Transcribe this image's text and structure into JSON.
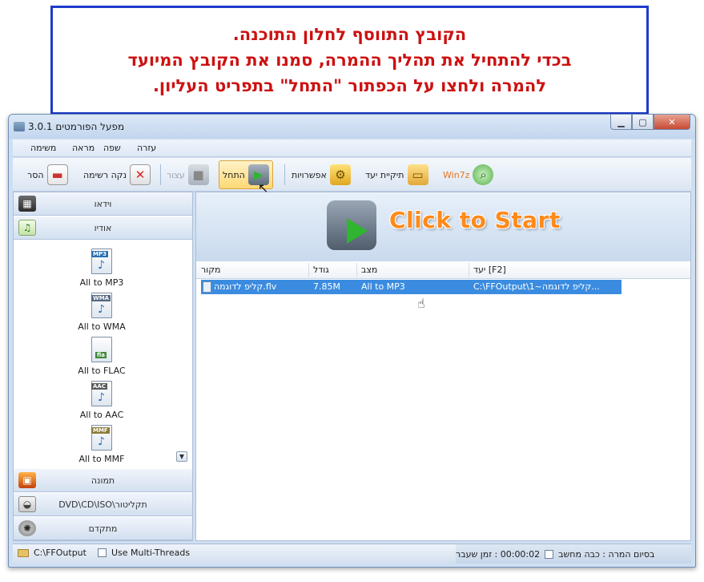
{
  "annotation": {
    "lines": [
      "הקובץ התווסף לחלון התוכנה.",
      "בכדי להתחיל את תהליך ההמרה, סמנו את הקובץ המיועד",
      "להמרה ולחצו על הכפתור \"התחל\" בתפריט העליון."
    ]
  },
  "window": {
    "title": "מפעל הפורמטים 3.0.1"
  },
  "menu": [
    "משימה",
    "מראה",
    "שפה",
    "עזרה"
  ],
  "toolbar": {
    "remove": "הסר",
    "clear_list": "נקה רשימה",
    "stop": "עצור",
    "start": "התחל",
    "options": "אפשרויות",
    "output_folder": "תיקיית יעד",
    "win7z": "Win7z"
  },
  "categories": {
    "video": "וידאו",
    "audio": "אודיו",
    "picture": "תמונה",
    "rom": "תקליטור\\DVD\\CD\\ISO",
    "advanced": "מתקדם"
  },
  "audio_items": [
    {
      "label": "All to MP3",
      "tag": "MP3"
    },
    {
      "label": "All to WMA",
      "tag": "WMA"
    },
    {
      "label": "All to FLAC",
      "tag": "fla"
    },
    {
      "label": "All to AAC",
      "tag": "AAC"
    },
    {
      "label": "All to MMF",
      "tag": "MMF"
    }
  ],
  "banner": {
    "text": "Click to Start"
  },
  "table": {
    "columns": [
      "מקור",
      "גודל",
      "מצב",
      "יעד [F2]"
    ],
    "rows": [
      {
        "source": "קליפ לדוגמה.flv",
        "size": "7.85M",
        "status": "All to MP3",
        "destination": "C:\\FFOutput\\1~קליפ לדוגמה..."
      }
    ]
  },
  "status": {
    "output_path": "C:\\FFOutput",
    "multithread": "Use Multi-Threads",
    "shutdown": "בסיום המרה : כבה מחשב",
    "elapsed": "00:00:02 : זמן שעבר"
  },
  "colors": {
    "accent": "#1f3bcc",
    "annotation_text": "#cc1111",
    "selection": "#3b8ce0",
    "banner_text": "#ff8a1a"
  }
}
